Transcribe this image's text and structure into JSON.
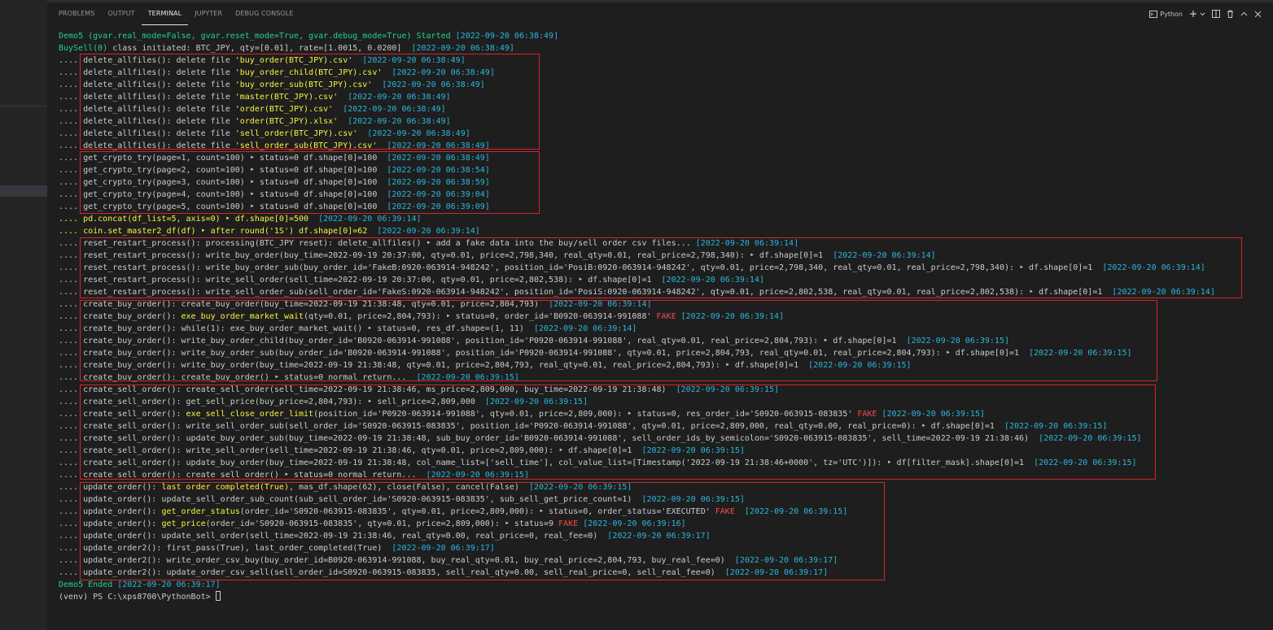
{
  "panel": {
    "tabs": [
      {
        "label": "PROBLEMS"
      },
      {
        "label": "OUTPUT"
      },
      {
        "label": "TERMINAL"
      },
      {
        "label": "JUPYTER"
      },
      {
        "label": "DEBUG CONSOLE"
      }
    ],
    "active_tab": "TERMINAL",
    "terminal_kind_label": "Python",
    "icons": [
      "terminal-icon",
      "plus-icon",
      "chevron-down-icon",
      "split-icon",
      "trash-icon",
      "chevron-up-icon",
      "close-icon"
    ]
  },
  "colors": {
    "timestamp": "#29b8db",
    "header_green": "#23d18b",
    "highlight_yellow": "#f5f543",
    "fake_red": "#f14c4c",
    "box_red": "#d3252b"
  },
  "lines": [
    {
      "class": "green",
      "parts": [
        {
          "c": "green",
          "t": "Demo5 (gvar.real_mode=False, gvar.reset_mode=True, gvar.debug_mode=True) Started "
        },
        {
          "c": "cyan",
          "t": "[2022-09-20 06:38:49]"
        }
      ]
    },
    {
      "class": "green",
      "parts": [
        {
          "c": "green",
          "t": "BuySell(0) "
        },
        {
          "c": "dim",
          "t": "class initiated: BTC_JPY, qty=[0.01], rate=[1.0015, 0.0200]  "
        },
        {
          "c": "cyan",
          "t": "[2022-09-20 06:38:49]"
        }
      ]
    },
    {
      "parts": [
        {
          "c": "dim",
          "t": ".... delete_allfiles(): delete file "
        },
        {
          "c": "yellow",
          "t": "'buy_order(BTC_JPY).csv'"
        },
        {
          "c": "dim",
          "t": "  "
        },
        {
          "c": "cyan",
          "t": "[2022-09-20 06:38:49]"
        }
      ]
    },
    {
      "parts": [
        {
          "c": "dim",
          "t": ".... delete_allfiles(): delete file "
        },
        {
          "c": "yellow",
          "t": "'buy_order_child(BTC_JPY).csv'"
        },
        {
          "c": "dim",
          "t": "  "
        },
        {
          "c": "cyan",
          "t": "[2022-09-20 06:38:49]"
        }
      ]
    },
    {
      "parts": [
        {
          "c": "dim",
          "t": ".... delete_allfiles(): delete file "
        },
        {
          "c": "yellow",
          "t": "'buy_order_sub(BTC_JPY).csv'"
        },
        {
          "c": "dim",
          "t": "  "
        },
        {
          "c": "cyan",
          "t": "[2022-09-20 06:38:49]"
        }
      ]
    },
    {
      "parts": [
        {
          "c": "dim",
          "t": ".... delete_allfiles(): delete file "
        },
        {
          "c": "yellow",
          "t": "'master(BTC_JPY).csv'"
        },
        {
          "c": "dim",
          "t": "  "
        },
        {
          "c": "cyan",
          "t": "[2022-09-20 06:38:49]"
        }
      ]
    },
    {
      "parts": [
        {
          "c": "dim",
          "t": ".... delete_allfiles(): delete file "
        },
        {
          "c": "yellow",
          "t": "'order(BTC_JPY).csv'"
        },
        {
          "c": "dim",
          "t": "  "
        },
        {
          "c": "cyan",
          "t": "[2022-09-20 06:38:49]"
        }
      ]
    },
    {
      "parts": [
        {
          "c": "dim",
          "t": ".... delete_allfiles(): delete file "
        },
        {
          "c": "yellow",
          "t": "'order(BTC_JPY).xlsx'"
        },
        {
          "c": "dim",
          "t": "  "
        },
        {
          "c": "cyan",
          "t": "[2022-09-20 06:38:49]"
        }
      ]
    },
    {
      "parts": [
        {
          "c": "dim",
          "t": ".... delete_allfiles(): delete file "
        },
        {
          "c": "yellow",
          "t": "'sell_order(BTC_JPY).csv'"
        },
        {
          "c": "dim",
          "t": "  "
        },
        {
          "c": "cyan",
          "t": "[2022-09-20 06:38:49]"
        }
      ]
    },
    {
      "parts": [
        {
          "c": "dim",
          "t": ".... delete_allfiles(): delete file "
        },
        {
          "c": "yellow",
          "t": "'sell_order_sub(BTC_JPY).csv'"
        },
        {
          "c": "dim",
          "t": "  "
        },
        {
          "c": "cyan",
          "t": "[2022-09-20 06:38:49]"
        }
      ]
    },
    {
      "parts": [
        {
          "c": "dim",
          "t": ".... get_crypto_try(page=1, count=100) ‣ status=0 df.shape[0]=100  "
        },
        {
          "c": "cyan",
          "t": "[2022-09-20 06:38:49]"
        }
      ]
    },
    {
      "parts": [
        {
          "c": "dim",
          "t": ".... get_crypto_try(page=2, count=100) ‣ status=0 df.shape[0]=100  "
        },
        {
          "c": "cyan",
          "t": "[2022-09-20 06:38:54]"
        }
      ]
    },
    {
      "parts": [
        {
          "c": "dim",
          "t": ".... get_crypto_try(page=3, count=100) ‣ status=0 df.shape[0]=100  "
        },
        {
          "c": "cyan",
          "t": "[2022-09-20 06:38:59]"
        }
      ]
    },
    {
      "parts": [
        {
          "c": "dim",
          "t": ".... get_crypto_try(page=4, count=100) ‣ status=0 df.shape[0]=100  "
        },
        {
          "c": "cyan",
          "t": "[2022-09-20 06:39:04]"
        }
      ]
    },
    {
      "parts": [
        {
          "c": "dim",
          "t": ".... get_crypto_try(page=5, count=100) ‣ status=0 df.shape[0]=100  "
        },
        {
          "c": "cyan",
          "t": "[2022-09-20 06:39:09]"
        }
      ]
    },
    {
      "parts": [
        {
          "c": "yellow",
          "t": ".... pd.concat(df_list=5, axis=0) ‣ df.shape[0]=500  "
        },
        {
          "c": "cyan",
          "t": "[2022-09-20 06:39:14]"
        }
      ]
    },
    {
      "parts": [
        {
          "c": "yellow",
          "t": ".... coin.set_master2_df(df) ‣ after round('1S') df.shape[0]=62  "
        },
        {
          "c": "cyan",
          "t": "[2022-09-20 06:39:14]"
        }
      ]
    },
    {
      "parts": [
        {
          "c": "dim",
          "t": ".... reset_restart_process(): processing(BTC_JPY reset): delete_allfiles() ‣ add a fake data into the buy/sell order csv files... "
        },
        {
          "c": "cyan",
          "t": "[2022-09-20 06:39:14]"
        }
      ]
    },
    {
      "parts": [
        {
          "c": "dim",
          "t": ".... reset_restart_process(): write_buy_order(buy_time=2022-09-19 20:37:00, qty=0.01, price=2,798,340, real_qty=0.01, real_price=2,798,340): ‣ df.shape[0]=1  "
        },
        {
          "c": "cyan",
          "t": "[2022-09-20 06:39:14]"
        }
      ]
    },
    {
      "parts": [
        {
          "c": "dim",
          "t": ".... reset_restart_process(): write_buy_order_sub(buy_order_id='FakeB:0920-063914-948242', position_id='PosiB:0920-063914-948242', qty=0.01, price=2,798,340, real_qty=0.01, real_price=2,798,340): ‣ df.shape[0]=1  "
        },
        {
          "c": "cyan",
          "t": "[2022-09-20 06:39:14]"
        }
      ]
    },
    {
      "parts": [
        {
          "c": "dim",
          "t": ".... reset_restart_process(): write_sell_order(sell_time=2022-09-19 20:37:00, qty=0.01, price=2,802,538): ‣ df.shape[0]=1  "
        },
        {
          "c": "cyan",
          "t": "[2022-09-20 06:39:14]"
        }
      ]
    },
    {
      "parts": [
        {
          "c": "dim",
          "t": ".... reset_restart_process(): write_sell_order_sub(sell_order_id='FakeS:0920-063914-948242', position_id='PosiS:0920-063914-948242', qty=0.01, price=2,802,538, real_qty=0.01, real_price=2,802,538): ‣ df.shape[0]=1  "
        },
        {
          "c": "cyan",
          "t": "[2022-09-20 06:39:14]"
        }
      ]
    },
    {
      "parts": [
        {
          "c": "dim",
          "t": ".... create_buy_order(): create_buy_order(buy_time=2022-09-19 21:38:48, qty=0.01, price=2,804,793)  "
        },
        {
          "c": "cyan",
          "t": "[2022-09-20 06:39:14]"
        }
      ]
    },
    {
      "parts": [
        {
          "c": "dim",
          "t": ".... create_buy_order(): "
        },
        {
          "c": "yellow",
          "t": "exe_buy_order_market_wait"
        },
        {
          "c": "dim",
          "t": "(qty=0.01, price=2,804,793): ‣ status=0, order_id='B0920-063914-991088' "
        },
        {
          "c": "red",
          "t": "FAKE"
        },
        {
          "c": "dim",
          "t": " "
        },
        {
          "c": "cyan",
          "t": "[2022-09-20 06:39:14]"
        }
      ]
    },
    {
      "parts": [
        {
          "c": "dim",
          "t": ".... create_buy_order(): while(1): exe_buy_order_market_wait() ‣ status=0, res_df.shape=(1, 11)  "
        },
        {
          "c": "cyan",
          "t": "[2022-09-20 06:39:14]"
        }
      ]
    },
    {
      "parts": [
        {
          "c": "dim",
          "t": ".... create_buy_order(): write_buy_order_child(buy_order_id='B0920-063914-991088', position_id='P0920-063914-991088', real_qty=0.01, real_price=2,804,793): ‣ df.shape[0]=1  "
        },
        {
          "c": "cyan",
          "t": "[2022-09-20 06:39:15]"
        }
      ]
    },
    {
      "parts": [
        {
          "c": "dim",
          "t": ".... create_buy_order(): write_buy_order_sub(buy_order_id='B0920-063914-991088', position_id='P0920-063914-991088', qty=0.01, price=2,804,793, real_qty=0.01, real_price=2,804,793): ‣ df.shape[0]=1  "
        },
        {
          "c": "cyan",
          "t": "[2022-09-20 06:39:15]"
        }
      ]
    },
    {
      "parts": [
        {
          "c": "dim",
          "t": ".... create_buy_order(): write_buy_order(buy_time=2022-09-19 21:38:48, qty=0.01, price=2,804,793, real_qty=0.01, real_price=2,804,793): ‣ df.shape[0]=1  "
        },
        {
          "c": "cyan",
          "t": "[2022-09-20 06:39:15]"
        }
      ]
    },
    {
      "parts": [
        {
          "c": "dim",
          "t": ".... create_buy_order(): create_buy_order() ‣ status=0 normal return...  "
        },
        {
          "c": "cyan",
          "t": "[2022-09-20 06:39:15]"
        }
      ]
    },
    {
      "parts": [
        {
          "c": "dim",
          "t": ".... create_sell_order(): create_sell_order(sell_time=2022-09-19 21:38:46, ms_price=2,809,000, buy_time=2022-09-19 21:38:48)  "
        },
        {
          "c": "cyan",
          "t": "[2022-09-20 06:39:15]"
        }
      ]
    },
    {
      "parts": [
        {
          "c": "dim",
          "t": ".... create_sell_order(): get_sell_price(buy_price=2,804,793): ‣ sell_price=2,809,000  "
        },
        {
          "c": "cyan",
          "t": "[2022-09-20 06:39:15]"
        }
      ]
    },
    {
      "parts": [
        {
          "c": "dim",
          "t": ".... create_sell_order(): "
        },
        {
          "c": "yellow",
          "t": "exe_sell_close_order_limit"
        },
        {
          "c": "dim",
          "t": "(position_id='P0920-063914-991088', qty=0.01, price=2,809,000): ‣ status=0, res_order_id='S0920-063915-083835' "
        },
        {
          "c": "red",
          "t": "FAKE"
        },
        {
          "c": "dim",
          "t": " "
        },
        {
          "c": "cyan",
          "t": "[2022-09-20 06:39:15]"
        }
      ]
    },
    {
      "parts": [
        {
          "c": "dim",
          "t": ".... create_sell_order(): write_sell_order_sub(sell_order_id='S0920-063915-083835', position_id='P0920-063914-991088', qty=0.01, price=2,809,000, real_qty=0.00, real_price=0): ‣ df.shape[0]=1  "
        },
        {
          "c": "cyan",
          "t": "[2022-09-20 06:39:15]"
        }
      ]
    },
    {
      "parts": [
        {
          "c": "dim",
          "t": ".... create_sell_order(): update_buy_order_sub(buy_time=2022-09-19 21:38:48, sub_buy_order_id='B0920-063914-991088', sell_order_ids_by_semicolon='S0920-063915-083835', sell_time=2022-09-19 21:38:46)  "
        },
        {
          "c": "cyan",
          "t": "[2022-09-20 06:39:15]"
        }
      ]
    },
    {
      "parts": [
        {
          "c": "dim",
          "t": ".... create_sell_order(): write_sell_order(sell_time=2022-09-19 21:38:46, qty=0.01, price=2,809,000): ‣ df.shape[0]=1  "
        },
        {
          "c": "cyan",
          "t": "[2022-09-20 06:39:15]"
        }
      ]
    },
    {
      "parts": [
        {
          "c": "dim",
          "t": ".... create_sell_order(): update_buy_order(buy_time=2022-09-19 21:38:48, col_name_list=['sell_time'], col_value_list=[Timestamp('2022-09-19 21:38:46+0000', tz='UTC')]): ‣ df[filter_mask].shape[0]=1  "
        },
        {
          "c": "cyan",
          "t": "[2022-09-20 06:39:15]"
        }
      ]
    },
    {
      "parts": [
        {
          "c": "dim",
          "t": ".... create_sell_order(): create_sell_order() ‣ status=0 normal return...  "
        },
        {
          "c": "cyan",
          "t": "[2022-09-20 06:39:15]"
        }
      ]
    },
    {
      "parts": [
        {
          "c": "dim",
          "t": ".... update_order(): "
        },
        {
          "c": "yellow",
          "t": "last order completed(True)"
        },
        {
          "c": "dim",
          "t": ", mas_df.shape(62), close(False), cancel(False)  "
        },
        {
          "c": "cyan",
          "t": "[2022-09-20 06:39:15]"
        }
      ]
    },
    {
      "parts": [
        {
          "c": "dim",
          "t": ".... update_order(): update_sell_order_sub_count(sub_sell_order_id='S0920-063915-083835', sub_sell_get_price_count=1)  "
        },
        {
          "c": "cyan",
          "t": "[2022-09-20 06:39:15]"
        }
      ]
    },
    {
      "parts": [
        {
          "c": "dim",
          "t": ".... update_order(): "
        },
        {
          "c": "yellow",
          "t": "get_order_status"
        },
        {
          "c": "dim",
          "t": "(order_id='S0920-063915-083835', qty=0.01, price=2,809,000): ‣ status=0, order_status='EXECUTED' "
        },
        {
          "c": "red",
          "t": "FAKE"
        },
        {
          "c": "dim",
          "t": "  "
        },
        {
          "c": "cyan",
          "t": "[2022-09-20 06:39:15]"
        }
      ]
    },
    {
      "parts": [
        {
          "c": "dim",
          "t": ".... update_order(): "
        },
        {
          "c": "yellow",
          "t": "get_price"
        },
        {
          "c": "dim",
          "t": "(order_id='S0920-063915-083835', qty=0.01, price=2,809,000): ‣ status=9 "
        },
        {
          "c": "red",
          "t": "FAKE"
        },
        {
          "c": "dim",
          "t": " "
        },
        {
          "c": "cyan",
          "t": "[2022-09-20 06:39:16]"
        }
      ]
    },
    {
      "parts": [
        {
          "c": "dim",
          "t": ".... update_order(): update_sell_order(sell_time=2022-09-19 21:38:46, real_qty=0.00, real_price=0, real_fee=0)  "
        },
        {
          "c": "cyan",
          "t": "[2022-09-20 06:39:17]"
        }
      ]
    },
    {
      "parts": [
        {
          "c": "dim",
          "t": ".... update_order2(): first_pass(True), last_order_completed(True)  "
        },
        {
          "c": "cyan",
          "t": "[2022-09-20 06:39:17]"
        }
      ]
    },
    {
      "parts": [
        {
          "c": "dim",
          "t": ".... update_order2(): write_order_csv_buy(buy_order_id=B0920-063914-991088, buy_real_qty=0.01, buy_real_price=2,804,793, buy_real_fee=0)  "
        },
        {
          "c": "cyan",
          "t": "[2022-09-20 06:39:17]"
        }
      ]
    },
    {
      "parts": [
        {
          "c": "dim",
          "t": ".... update_order2(): update_order_csv_sell(sell_order_id=S0920-063915-083835, sell_real_qty=0.00, sell_real_price=0, sell_real_fee=0)  "
        },
        {
          "c": "cyan",
          "t": "[2022-09-20 06:39:17]"
        }
      ]
    },
    {
      "parts": [
        {
          "c": "green",
          "t": "Demo5 Ended "
        },
        {
          "c": "cyan",
          "t": "[2022-09-20 06:39:17]"
        }
      ]
    },
    {
      "parts": [
        {
          "c": "prompt",
          "t": "(venv) PS C:\\xps8700\\PythonBot> "
        }
      ],
      "cursor": true
    }
  ]
}
